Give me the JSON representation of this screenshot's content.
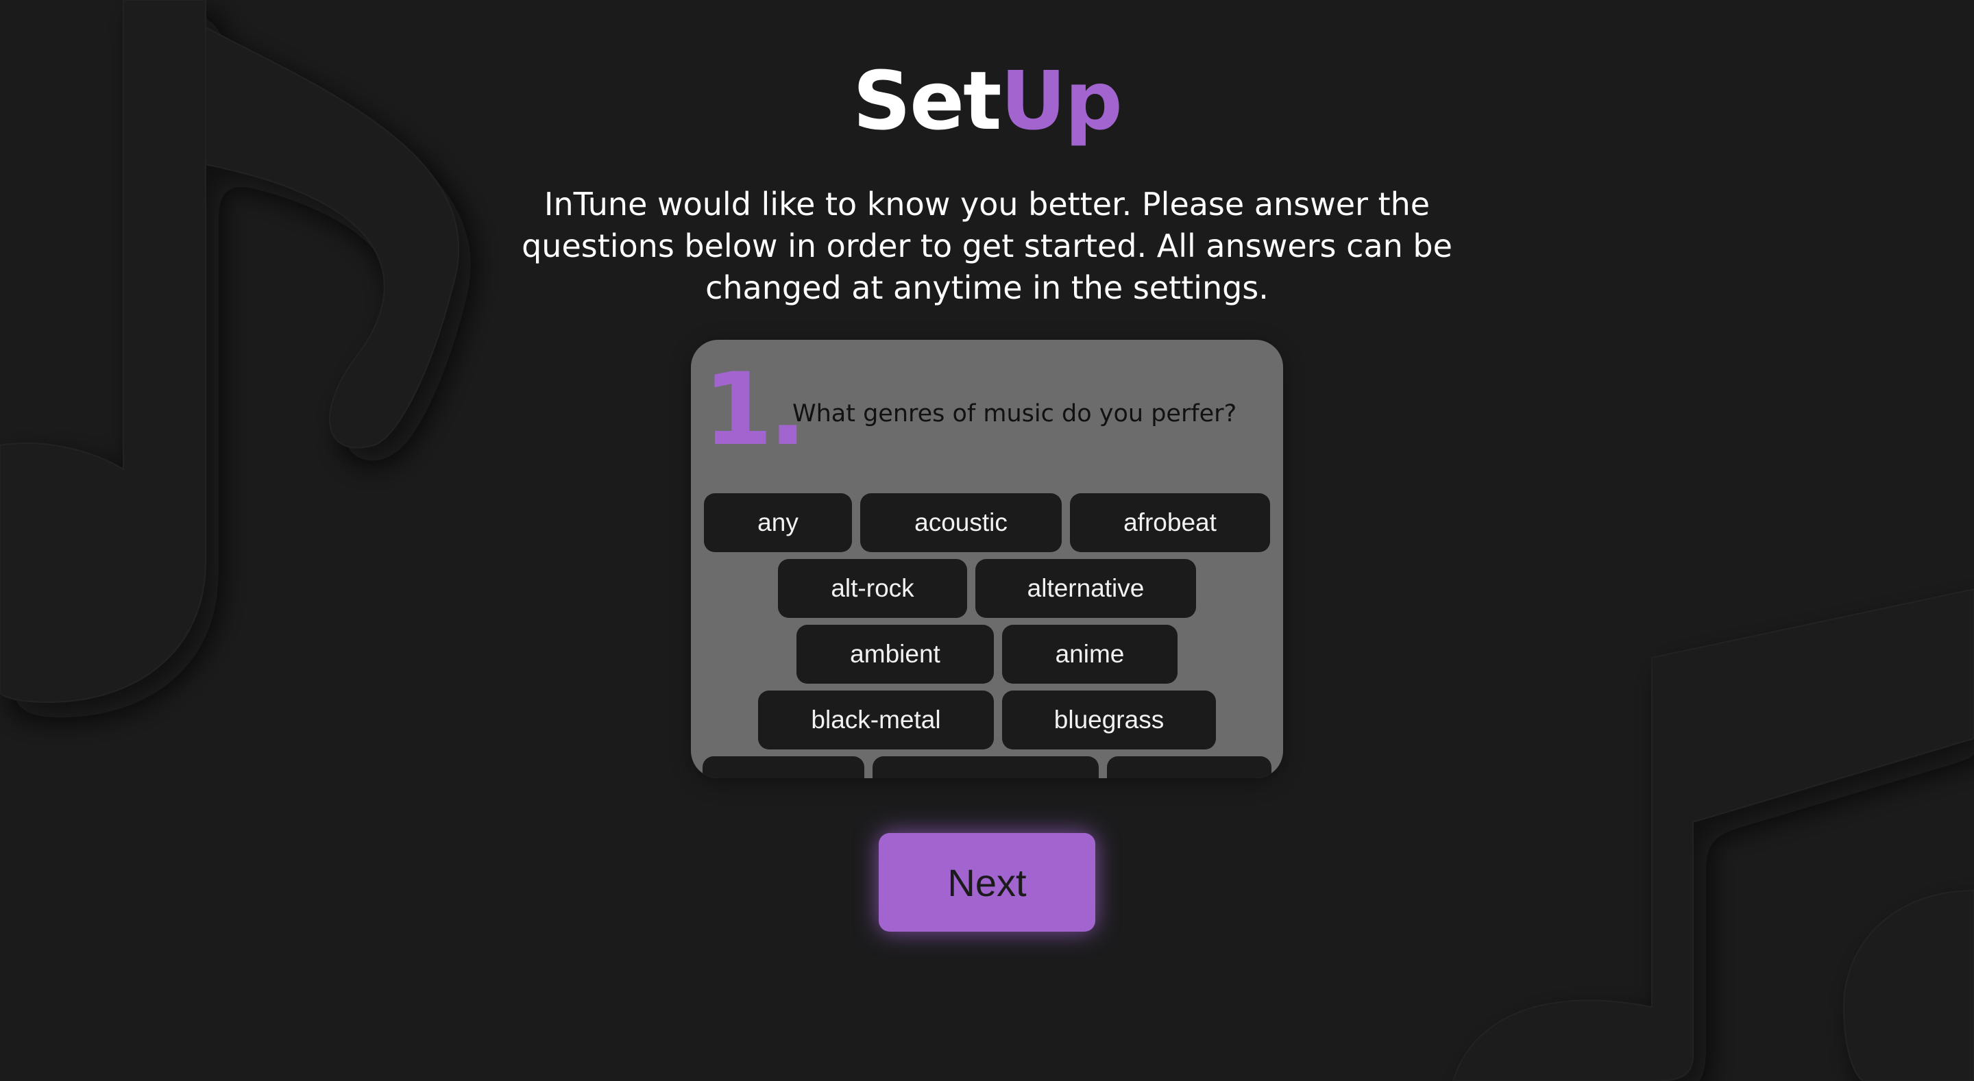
{
  "header": {
    "title_part1": "Set",
    "title_part2": "Up"
  },
  "intro": {
    "text": "InTune would like to know you better. Please answer the questions below in order to get started. All answers can be changed at anytime in the settings."
  },
  "question": {
    "number": "1.",
    "text": "What genres of music do you perfer?"
  },
  "genres": [
    "any",
    "acoustic",
    "afrobeat",
    "alt-rock",
    "alternative",
    "ambient",
    "anime",
    "black-metal",
    "bluegrass"
  ],
  "actions": {
    "next_label": "Next"
  },
  "colors": {
    "background": "#1b1b1c",
    "accent": "#a264cf",
    "card": "#6c6c6c",
    "chip": "#1b1b1c"
  },
  "icons": {
    "background_decoration": "music-note-icon"
  }
}
